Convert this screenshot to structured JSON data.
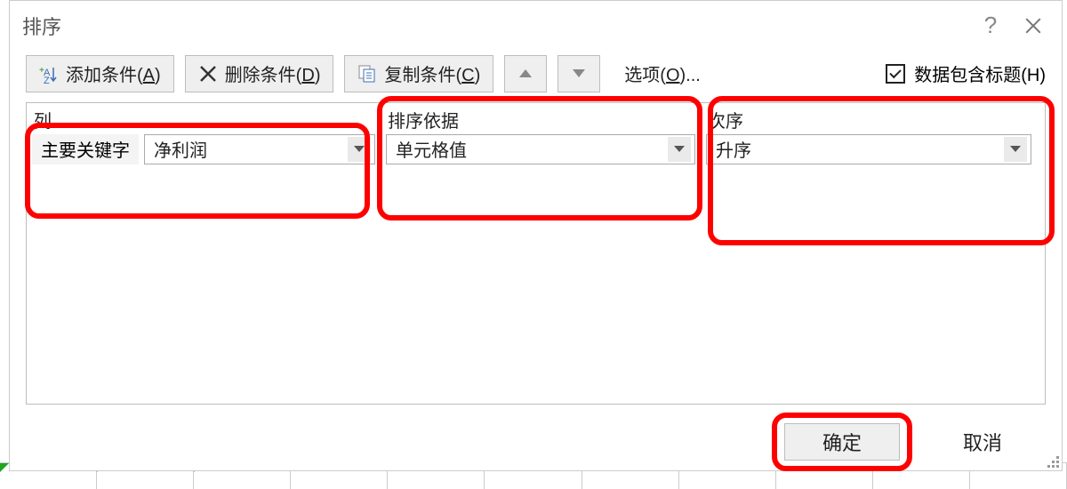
{
  "dialog": {
    "title": "排序"
  },
  "toolbar": {
    "add_label_pre": "添加条件(",
    "add_label_key": "A",
    "add_label_post": ")",
    "delete_label_pre": "删除条件(",
    "delete_label_key": "D",
    "delete_label_post": ")",
    "copy_label_pre": "复制条件(",
    "copy_label_key": "C",
    "copy_label_post": ")",
    "options_label_pre": "选项(",
    "options_label_key": "O",
    "options_label_post": ")...",
    "header_checkbox_label_pre": "数据包含标题(",
    "header_checkbox_label_key": "H",
    "header_checkbox_label_post": ")",
    "header_checkbox_checked": true
  },
  "columns": {
    "col1": "列",
    "col2": "排序依据",
    "col3": "次序"
  },
  "row": {
    "primary_key_label": "主要关键字",
    "column_value": "净利润",
    "sort_on_value": "单元格值",
    "order_value": "升序"
  },
  "footer": {
    "ok_label": "确定",
    "cancel_label": "取消"
  }
}
